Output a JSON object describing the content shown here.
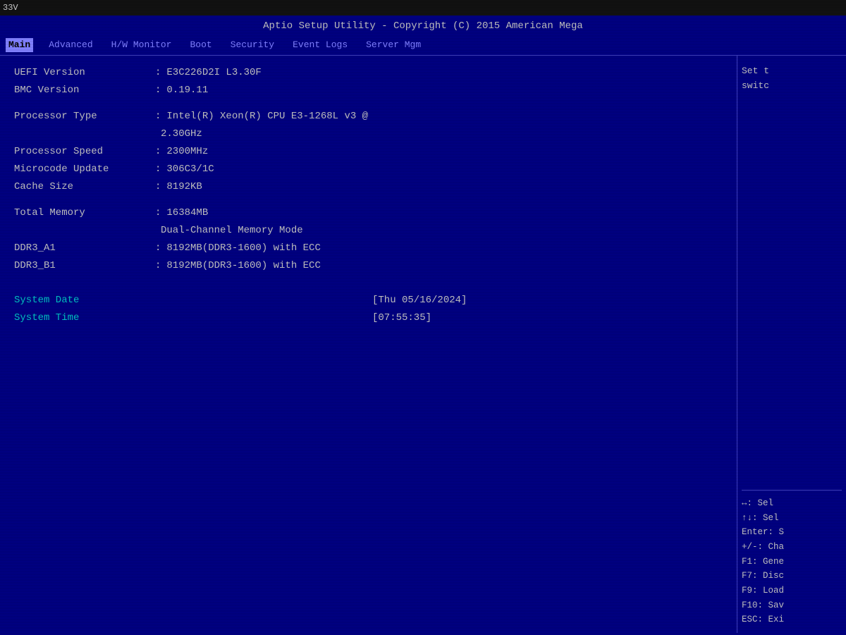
{
  "topbar": {
    "voltage": "33V"
  },
  "title": "Aptio Setup Utility - Copyright (C) 2015 American Mega",
  "nav": {
    "items": [
      {
        "label": "Main",
        "active": true
      },
      {
        "label": "Advanced",
        "active": false
      },
      {
        "label": "H/W Monitor",
        "active": false
      },
      {
        "label": "Boot",
        "active": false
      },
      {
        "label": "Security",
        "active": false
      },
      {
        "label": "Event Logs",
        "active": false
      },
      {
        "label": "Server Mgm",
        "active": false
      }
    ]
  },
  "main": {
    "fields": [
      {
        "label": "UEFI Version",
        "value": "E3C226D2I L3.30F"
      },
      {
        "label": "BMC Version",
        "value": "0.19.11"
      }
    ],
    "processor": [
      {
        "label": "Processor Type",
        "value": "Intel(R) Xeon(R) CPU E3-1268L v3 @"
      },
      {
        "label": "",
        "value": "2.30GHz"
      },
      {
        "label": "Processor Speed",
        "value": "2300MHz"
      },
      {
        "label": "Microcode Update",
        "value": "306C3/1C"
      },
      {
        "label": "Cache Size",
        "value": "8192KB"
      }
    ],
    "memory": [
      {
        "label": "Total Memory",
        "value": "16384MB"
      },
      {
        "label": "",
        "value": "Dual-Channel Memory Mode"
      },
      {
        "label": "DDR3_A1",
        "value": "8192MB(DDR3-1600) with ECC"
      },
      {
        "label": "DDR3_B1",
        "value": "8192MB(DDR3-1600) with ECC"
      }
    ],
    "datetime": [
      {
        "label": "System Date",
        "value": "[Thu 05/16/2024]"
      },
      {
        "label": "System Time",
        "value": "[07:55:35]"
      }
    ]
  },
  "sidebar": {
    "top_text_line1": "Set t",
    "top_text_line2": "switc",
    "help": [
      {
        "key": "↔: Sel"
      },
      {
        "key": "↑↓: Sel"
      },
      {
        "key": "Enter: S"
      },
      {
        "key": "+/-: Cha"
      },
      {
        "key": "F1: Gene"
      },
      {
        "key": "F7: Disc"
      },
      {
        "key": "F9: Load"
      },
      {
        "key": "F10: Sav"
      },
      {
        "key": "ESC: Exi"
      }
    ]
  }
}
